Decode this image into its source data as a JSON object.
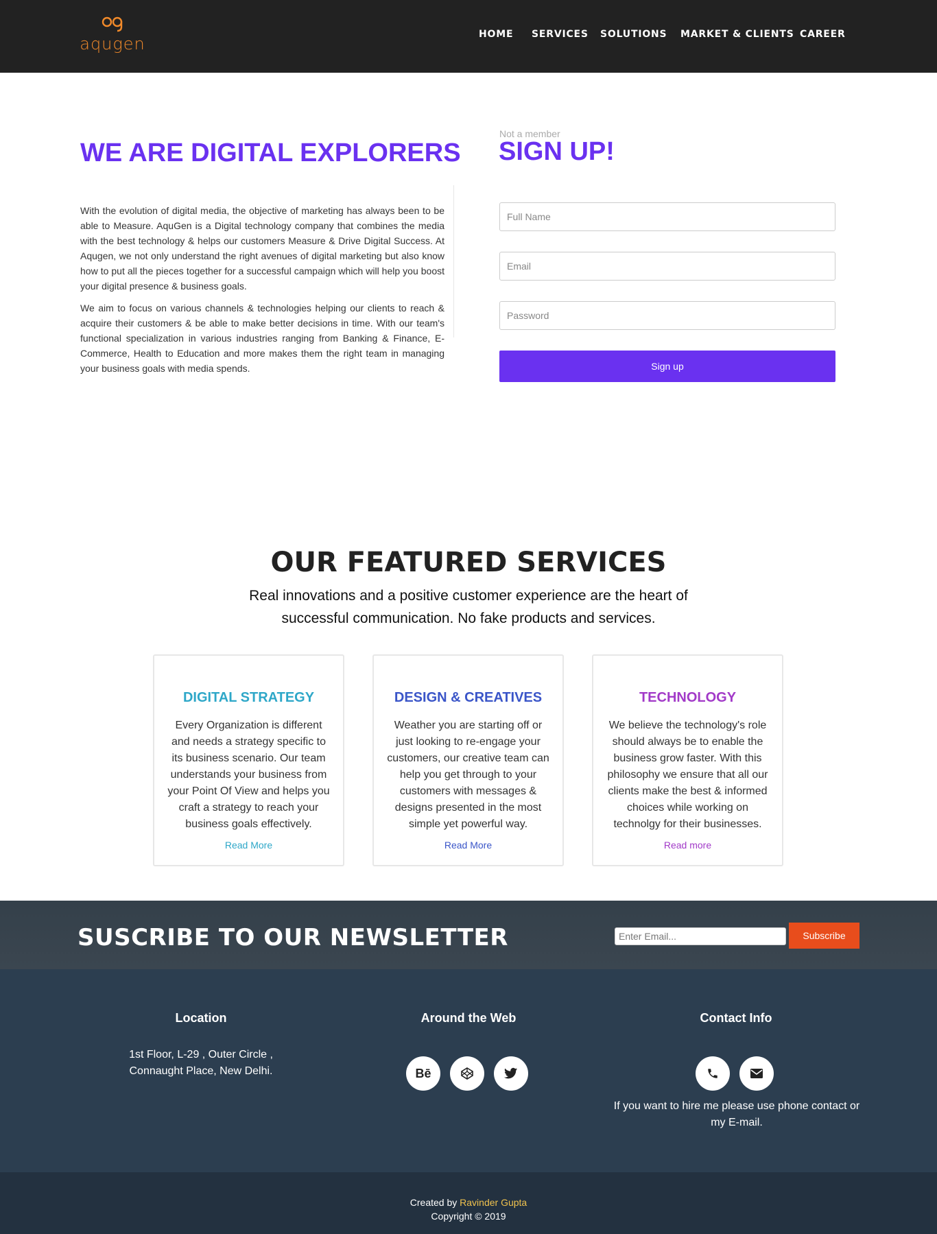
{
  "header": {
    "logo_text": "aqugen",
    "nav": [
      "HOME",
      "SERVICES",
      "SOLUTIONS",
      "MARKET & CLIENTS",
      "CAREER"
    ]
  },
  "intro": {
    "title": "WE ARE DIGITAL EXPLORERS",
    "paragraphs": [
      "With the evolution of digital media, the objective of marketing has always been to be able to Measure. AquGen is a Digital technology company that combines the media with the best technology & helps our customers Measure & Drive Digital Success. At Aqugen, we not only understand the right avenues of digital marketing but also know how to put all the pieces together for a successful campaign which will help you boost your digital presence & business goals.",
      "We aim to focus on various channels & technologies helping our clients to reach & acquire their customers & be able to make better decisions in time. With our team's functional specialization in various industries ranging from Banking & Finance, E-Commerce, Health to Education and more makes them the right team in managing your business goals with media spends."
    ]
  },
  "signup": {
    "pre_title": "Not a member",
    "title": "SIGN UP!",
    "full_name_placeholder": "Full Name",
    "email_placeholder": "Email",
    "password_placeholder": "Password",
    "button_label": "Sign up",
    "accent_color": "#6a31f0"
  },
  "services": {
    "title": "OUR FEATURED SERVICES",
    "subtitle": "Real innovations and a positive customer experience are the heart of successful communication. No fake products and services.",
    "cards": [
      {
        "title": "DIGITAL STRATEGY",
        "text": "Every Organization is different and needs a strategy specific to its business scenario. Our team understands your business from your Point Of View and helps you craft a strategy to reach your business goals effectively.",
        "link": "Read More",
        "color": "#2ea7c8"
      },
      {
        "title": "DESIGN & CREATIVES",
        "text": "Weather you are starting off or just looking to re-engage your customers, our creative team can help you get through to your customers with messages & designs presented in the most simple yet powerful way.",
        "link": "Read More",
        "color": "#3a55c8"
      },
      {
        "title": "TECHNOLOGY",
        "text": "We believe the technology's role should always be to enable the business grow faster. With this philosophy we ensure that all our clients make the best & informed choices while working on technolgy for their businesses.",
        "link": "Read more",
        "color": "#a23ac8"
      }
    ]
  },
  "newsletter": {
    "title": "SUSCRIBE TO OUR NEWSLETTER",
    "placeholder": "Enter Email...",
    "button_label": "Subscribe",
    "button_color": "#e84d1c"
  },
  "footer": {
    "location": {
      "heading": "Location",
      "text": "1st Floor, L-29 , Outer Circle , Connaught Place, New Delhi."
    },
    "web": {
      "heading": "Around the Web",
      "icons": [
        "behance-icon",
        "codepen-icon",
        "twitter-icon"
      ],
      "behance_glyph": "Bē"
    },
    "contact": {
      "heading": "Contact Info",
      "icons": [
        "phone-icon",
        "envelope-icon"
      ],
      "text": "If you want to hire me please use phone contact or my E-mail."
    }
  },
  "bottom": {
    "created_by": "Created by",
    "author": "Ravinder Gupta",
    "copyright": "Copyright © 2019"
  }
}
